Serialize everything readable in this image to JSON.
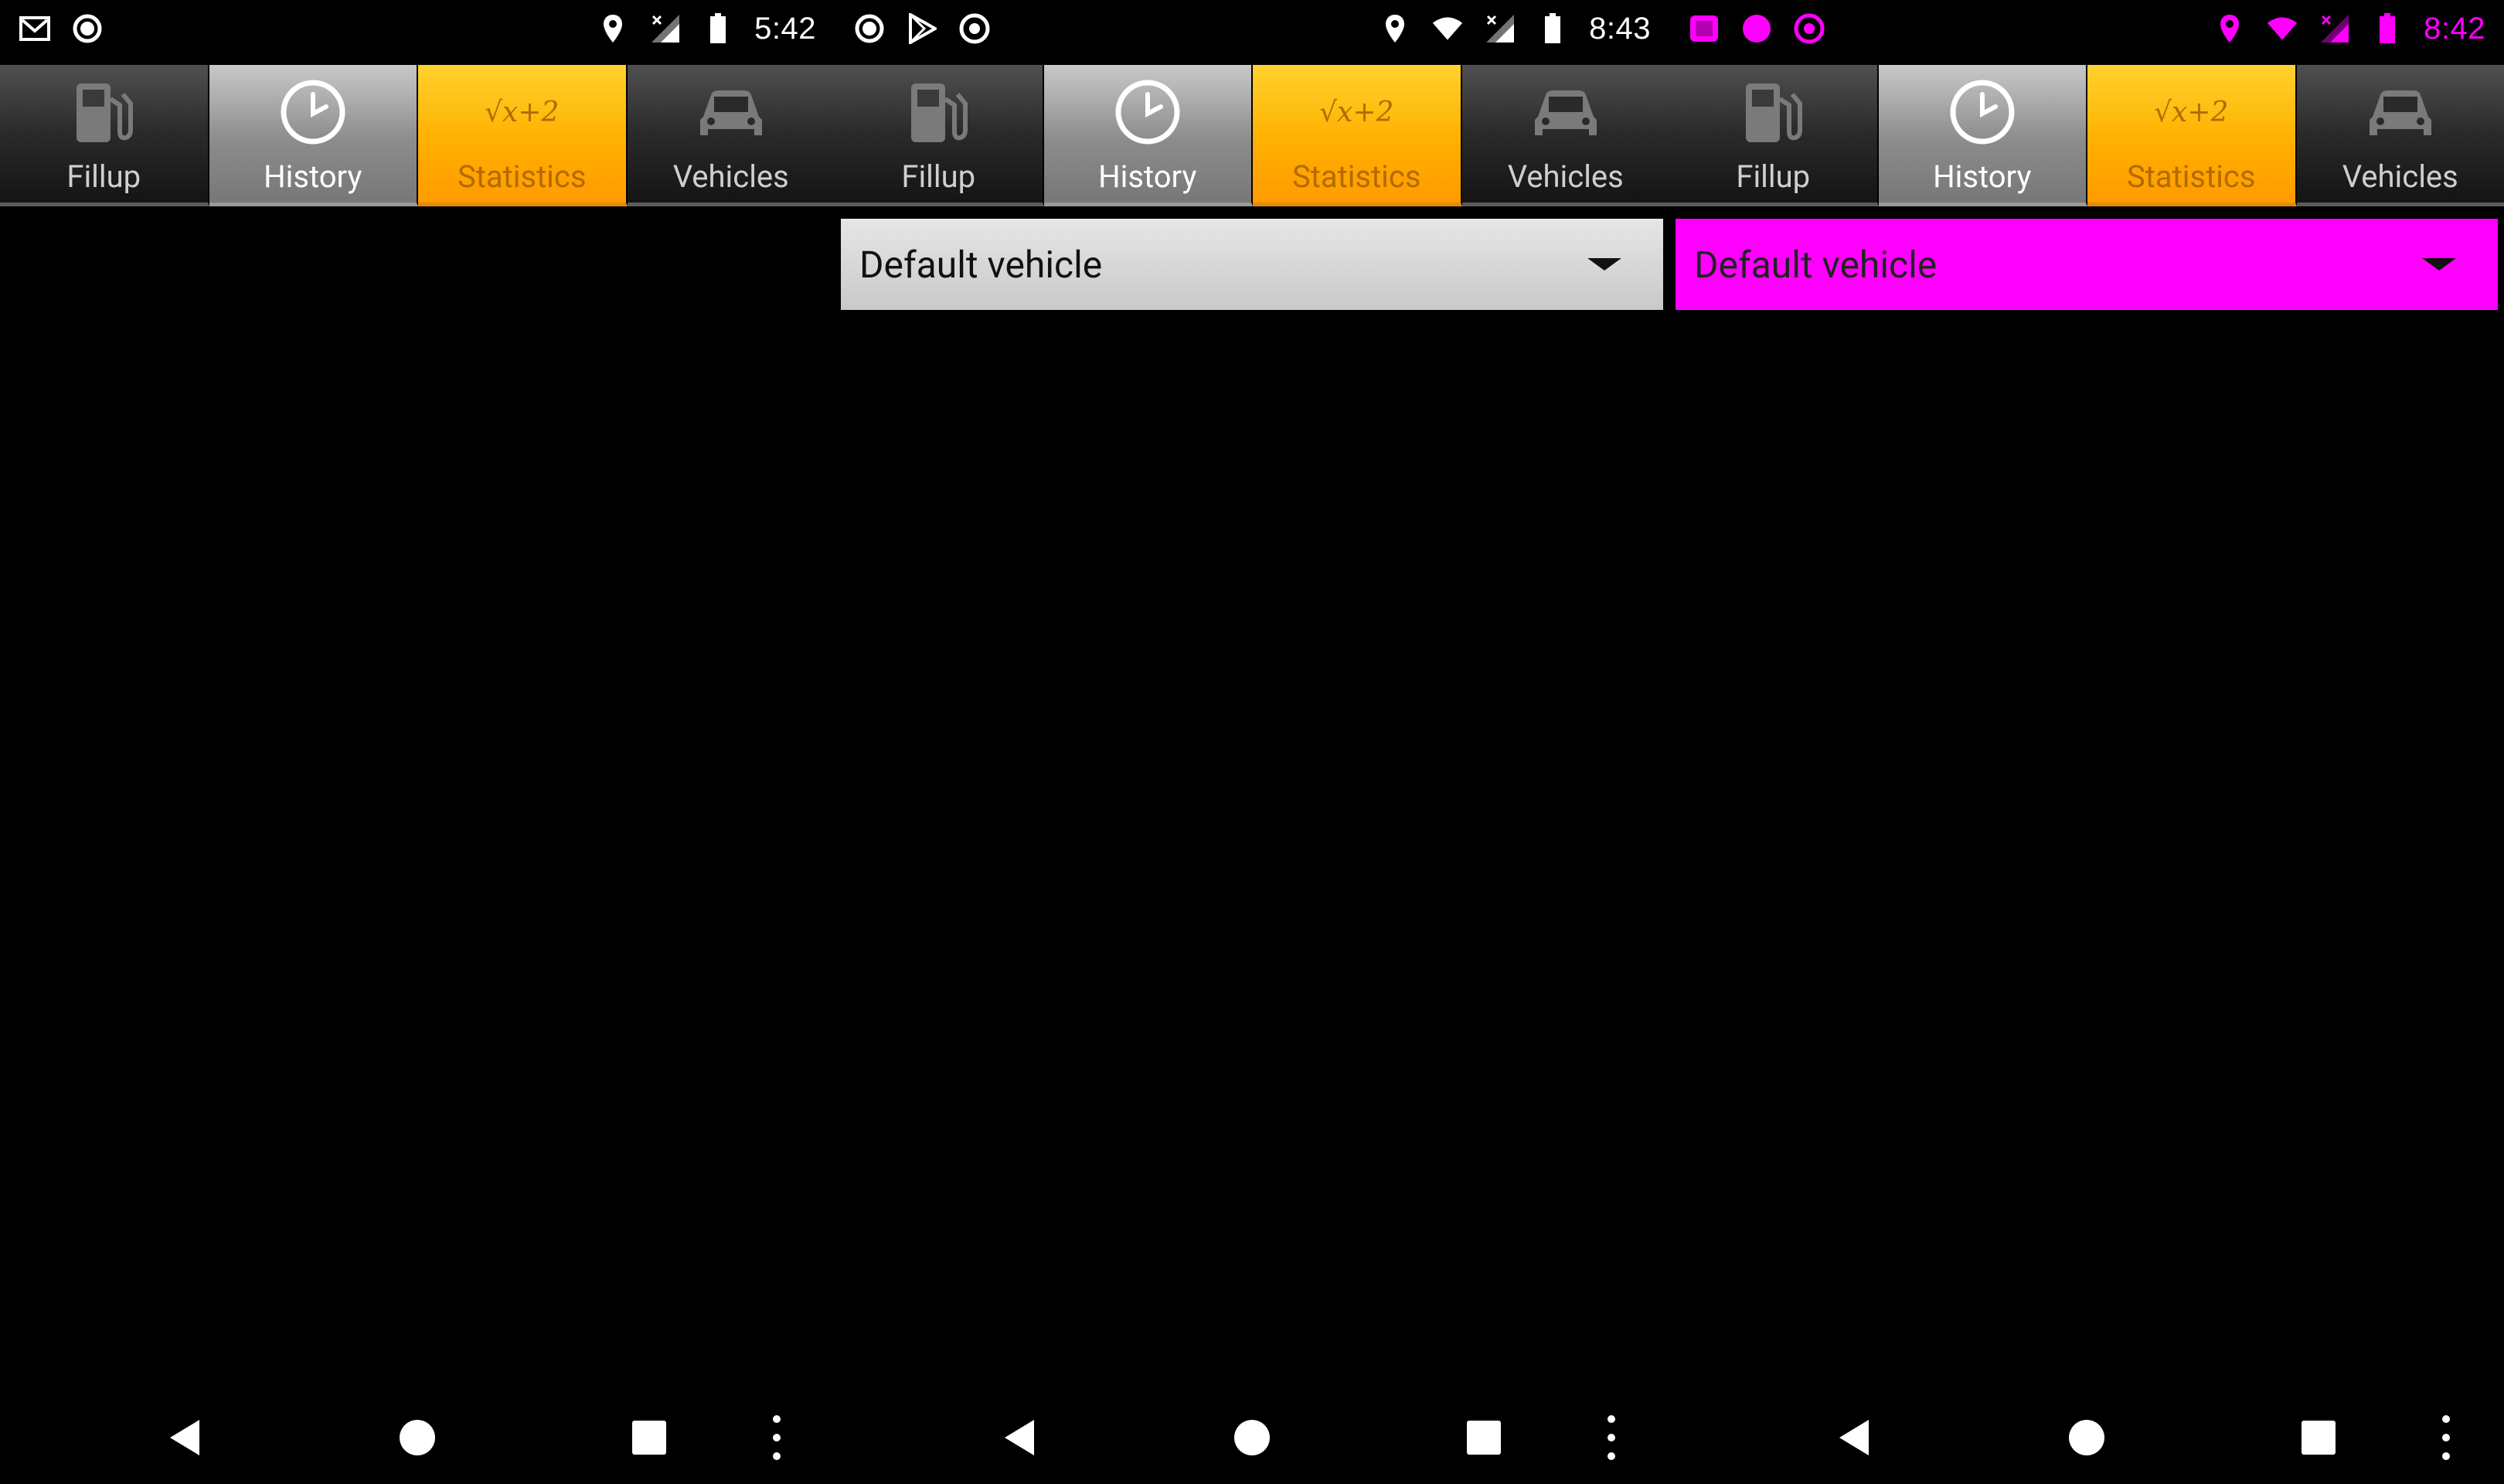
{
  "colors": {
    "tab_selected": "#a6a6a6",
    "tab_statistics": "#ffb000",
    "accent_magenta": "#ff00ff",
    "background": "#000000"
  },
  "panels": [
    {
      "status": {
        "time": "5:42",
        "left_icons": [
          "gmail-icon",
          "circle-notification-icon"
        ],
        "right_icons": [
          "location-icon",
          "no-signal-icon",
          "battery-icon"
        ]
      },
      "tabs": [
        {
          "label": "Fillup",
          "icon": "fuel-pump-icon"
        },
        {
          "label": "History",
          "icon": "clock-icon"
        },
        {
          "label": "Statistics",
          "icon": "sqrt-x-plus-2-icon",
          "icon_text": "√x+2"
        },
        {
          "label": "Vehicles",
          "icon": "car-icon"
        }
      ],
      "selected_tab": "History",
      "spinner": null
    },
    {
      "status": {
        "time": "8:43",
        "left_icons": [
          "circle-notification-icon",
          "play-store-icon",
          "chrome-icon"
        ],
        "right_icons": [
          "location-icon",
          "wifi-icon",
          "no-signal-icon",
          "battery-icon"
        ]
      },
      "tabs": [
        {
          "label": "Fillup",
          "icon": "fuel-pump-icon"
        },
        {
          "label": "History",
          "icon": "clock-icon"
        },
        {
          "label": "Statistics",
          "icon": "sqrt-x-plus-2-icon",
          "icon_text": "√x+2"
        },
        {
          "label": "Vehicles",
          "icon": "car-icon"
        }
      ],
      "selected_tab": "History",
      "spinner": {
        "value": "Default vehicle",
        "style": "gray"
      }
    },
    {
      "status": {
        "time": "8:42",
        "left_icons": [
          "notification-icon",
          "circle-notification-icon",
          "chrome-icon"
        ],
        "right_icons": [
          "location-icon",
          "wifi-icon",
          "no-signal-icon",
          "battery-icon"
        ],
        "tint": "#ff00ff"
      },
      "tabs": [
        {
          "label": "Fillup",
          "icon": "fuel-pump-icon"
        },
        {
          "label": "History",
          "icon": "clock-icon"
        },
        {
          "label": "Statistics",
          "icon": "sqrt-x-plus-2-icon",
          "icon_text": "√x+2"
        },
        {
          "label": "Vehicles",
          "icon": "car-icon"
        }
      ],
      "selected_tab": "History",
      "spinner": {
        "value": "Default vehicle",
        "style": "magenta"
      }
    }
  ],
  "navbar": {
    "buttons": [
      "back-icon",
      "home-icon",
      "recent-apps-icon",
      "overflow-menu-icon"
    ]
  }
}
